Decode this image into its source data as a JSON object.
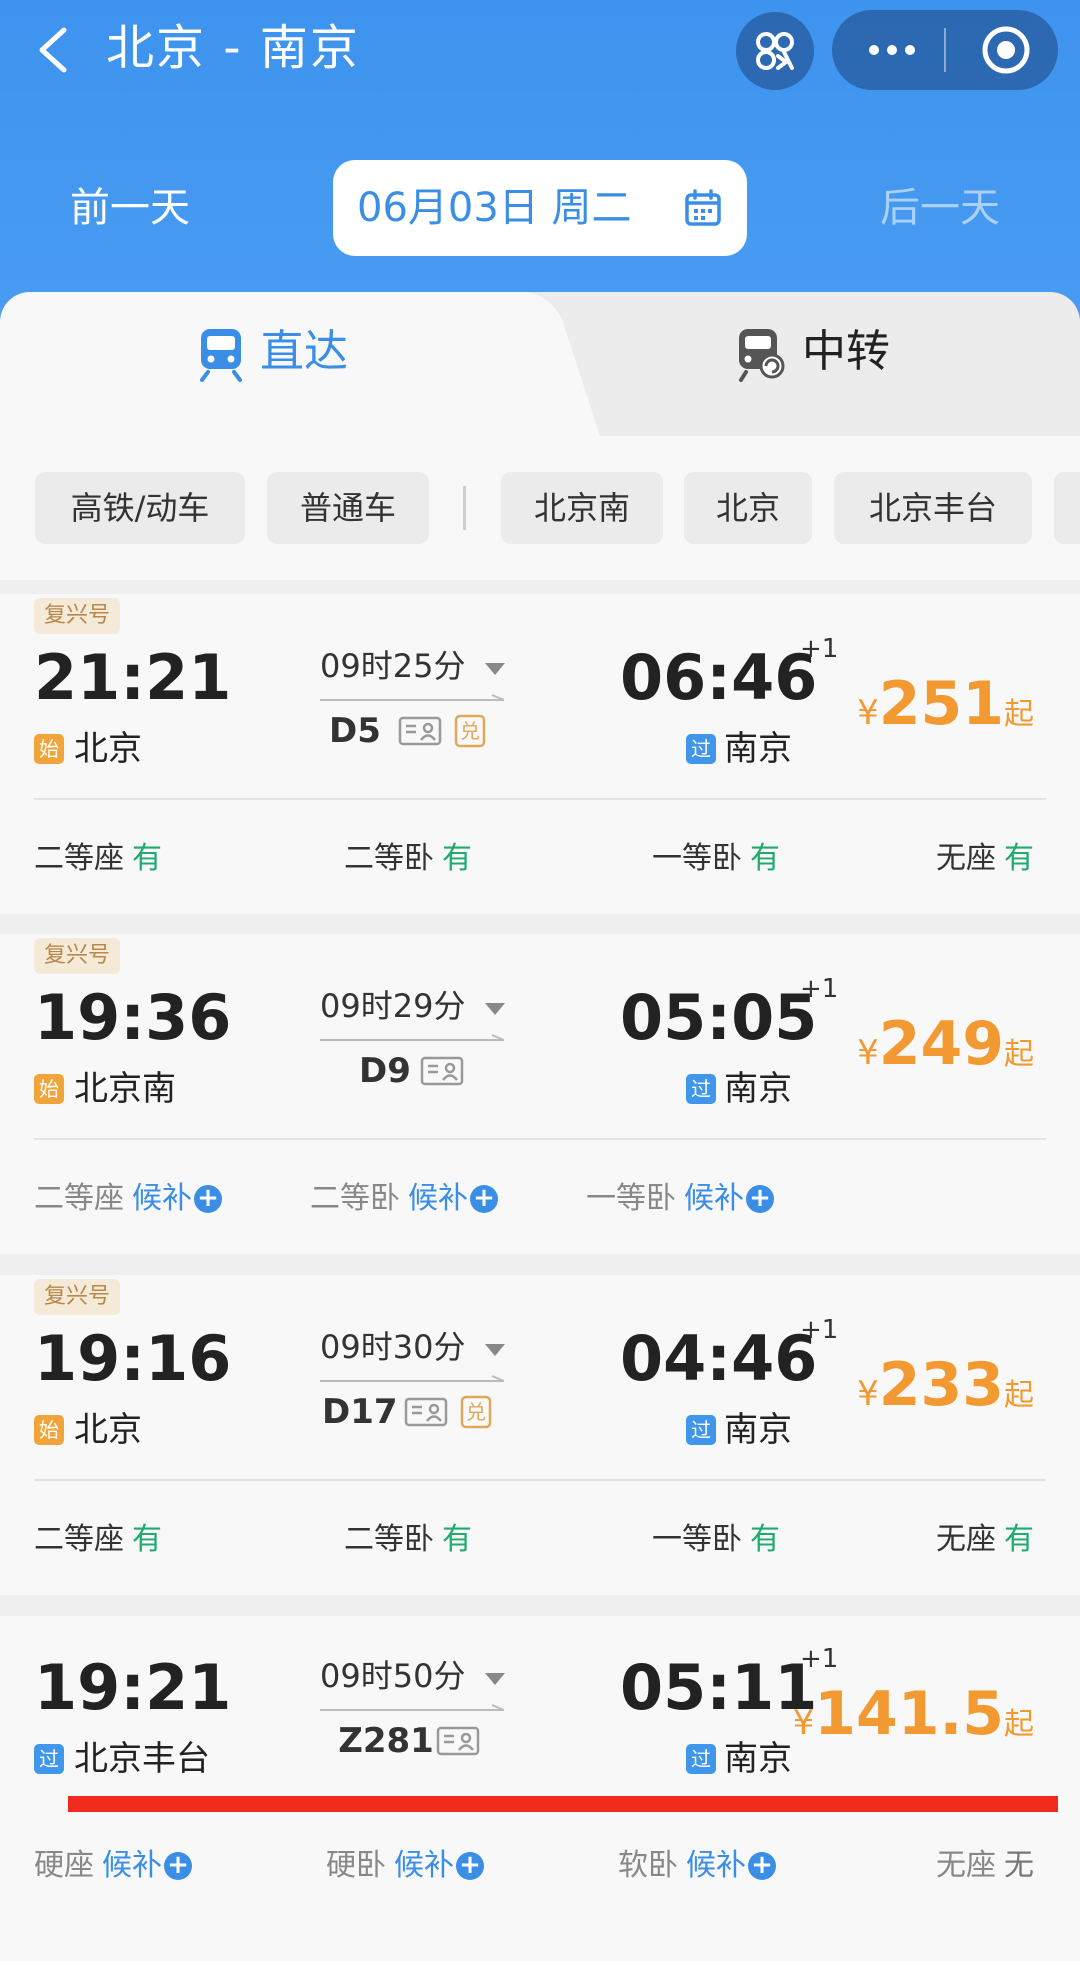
{
  "header": {
    "route_title": "北京 - 南京",
    "prev_day": "前一天",
    "date": "06月03日 周二",
    "next_day": "后一天"
  },
  "tabs": {
    "direct": "直达",
    "transfer": "中转"
  },
  "filters": [
    "高铁/动车",
    "普通车",
    "北京南",
    "北京",
    "北京丰台"
  ],
  "labels": {
    "yen": "¥",
    "qi": "起",
    "plus_one": "+1",
    "start_tag": "始",
    "pass_tag": "过",
    "fuxing": "复兴号",
    "dui": "兑"
  },
  "trains": [
    {
      "badge": "复兴号",
      "dep_time": "21:21",
      "dep_tag": "始",
      "dep_station": "北京",
      "duration": "09时25分",
      "train_no": "D5",
      "arr_time": "06:46",
      "arr_tag": "过",
      "arr_station": "南京",
      "price": "251",
      "seats": [
        {
          "name": "二等座",
          "status": "有"
        },
        {
          "name": "二等卧",
          "status": "有"
        },
        {
          "name": "一等卧",
          "status": "有"
        },
        {
          "name": "无座",
          "status": "有"
        }
      ]
    },
    {
      "badge": "复兴号",
      "dep_time": "19:36",
      "dep_tag": "始",
      "dep_station": "北京南",
      "duration": "09时29分",
      "train_no": "D9",
      "arr_time": "05:05",
      "arr_tag": "过",
      "arr_station": "南京",
      "price": "249",
      "seats": [
        {
          "name": "二等座",
          "status": "候补"
        },
        {
          "name": "二等卧",
          "status": "候补"
        },
        {
          "name": "一等卧",
          "status": "候补"
        }
      ]
    },
    {
      "badge": "复兴号",
      "dep_time": "19:16",
      "dep_tag": "始",
      "dep_station": "北京",
      "duration": "09时30分",
      "train_no": "D17",
      "arr_time": "04:46",
      "arr_tag": "过",
      "arr_station": "南京",
      "price": "233",
      "seats": [
        {
          "name": "二等座",
          "status": "有"
        },
        {
          "name": "二等卧",
          "status": "有"
        },
        {
          "name": "一等卧",
          "status": "有"
        },
        {
          "name": "无座",
          "status": "有"
        }
      ]
    },
    {
      "dep_time": "19:21",
      "dep_tag": "过",
      "dep_station": "北京丰台",
      "duration": "09时50分",
      "train_no": "Z281",
      "arr_time": "05:11",
      "arr_tag": "过",
      "arr_station": "南京",
      "price": "141.5",
      "seats": [
        {
          "name": "硬座",
          "status": "候补"
        },
        {
          "name": "硬卧",
          "status": "候补"
        },
        {
          "name": "软卧",
          "status": "候补"
        },
        {
          "name": "无座",
          "status": "无"
        }
      ]
    }
  ],
  "colors": {
    "header_blue": "#4a9cf2",
    "accent_blue": "#3a8ee6",
    "price_orange": "#f29a31",
    "available_green": "#1faa6e",
    "highlight_red": "#f12a1e"
  }
}
